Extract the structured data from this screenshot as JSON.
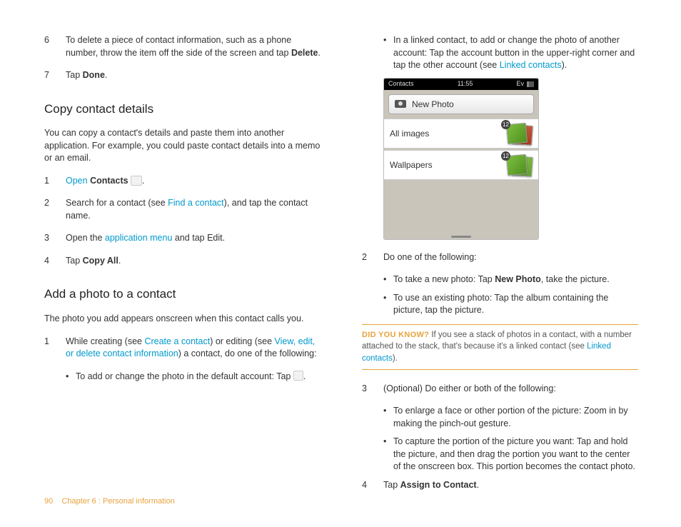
{
  "left": {
    "step6": {
      "num": "6",
      "t1": "To delete a piece of contact information, such as a phone number, throw the item off the side of the screen and tap ",
      "bold": "Delete",
      "t2": "."
    },
    "step7": {
      "num": "7",
      "t1": "Tap ",
      "bold": "Done",
      "t2": "."
    },
    "h_copy": "Copy contact details",
    "p_copy": "You can copy a contact's details and paste them into another application. For example, you could paste contact details into a memo or an email.",
    "copy1": {
      "num": "1",
      "open": "Open",
      "contacts": "Contacts",
      "t2": "."
    },
    "copy2": {
      "num": "2",
      "t1": "Search for a contact (see ",
      "link": "Find a contact",
      "t2": "), and tap the contact name."
    },
    "copy3": {
      "num": "3",
      "t1": "Open the ",
      "link": "application menu",
      "t2": " and tap Edit."
    },
    "copy4": {
      "num": "4",
      "t1": "Tap ",
      "bold": "Copy All",
      "t2": "."
    },
    "h_add": "Add a photo to a contact",
    "p_add": "The photo you add appears onscreen when this contact calls you.",
    "add1": {
      "num": "1",
      "t1": "While creating (see ",
      "link1": "Create a contact",
      "t2": ") or editing (see ",
      "link2": "View, edit, or delete contact information",
      "t3": ") a contact, do one of the following:"
    },
    "add1b": {
      "t1": "To add or change the photo in the default account: Tap ",
      "t2": "."
    }
  },
  "right": {
    "intro": {
      "t1": "In a linked contact, to add or change the photo of another account: Tap the account button in the upper-right corner and tap the other account (see ",
      "link": "Linked contacts",
      "t2": ")."
    },
    "phone": {
      "status_left": "Contacts",
      "time": "11:55",
      "ev": "Ev",
      "new_photo": "New Photo",
      "row1": "All images",
      "row2": "Wallpapers",
      "badge": "12"
    },
    "step2": {
      "num": "2",
      "t": "Do one of the following:"
    },
    "step2a": {
      "t1": "To take a new photo: Tap ",
      "bold": "New Photo",
      "t2": ", take the picture."
    },
    "step2b": {
      "t": "To use an existing photo: Tap the album containing the picture, tap the picture."
    },
    "callout": {
      "lead": "DID YOU KNOW?",
      "t1": "  If you see a stack of photos in a contact, with a number attached to the stack, that's because it's a linked contact (see ",
      "link": "Linked contacts",
      "t2": ")."
    },
    "step3": {
      "num": "3",
      "t": "(Optional) Do either or both of the following:"
    },
    "step3a": {
      "t": "To enlarge a face or other portion of the picture: Zoom in by making the pinch-out gesture."
    },
    "step3b": {
      "t": "To capture the portion of the picture you want: Tap and hold the picture, and then drag the portion you want to the center of the onscreen box. This portion becomes the contact photo."
    },
    "step4": {
      "num": "4",
      "t1": "Tap ",
      "bold": "Assign to Contact",
      "t2": "."
    }
  },
  "footer": {
    "page": "90",
    "chapter": "Chapter 6 : Personal information"
  }
}
